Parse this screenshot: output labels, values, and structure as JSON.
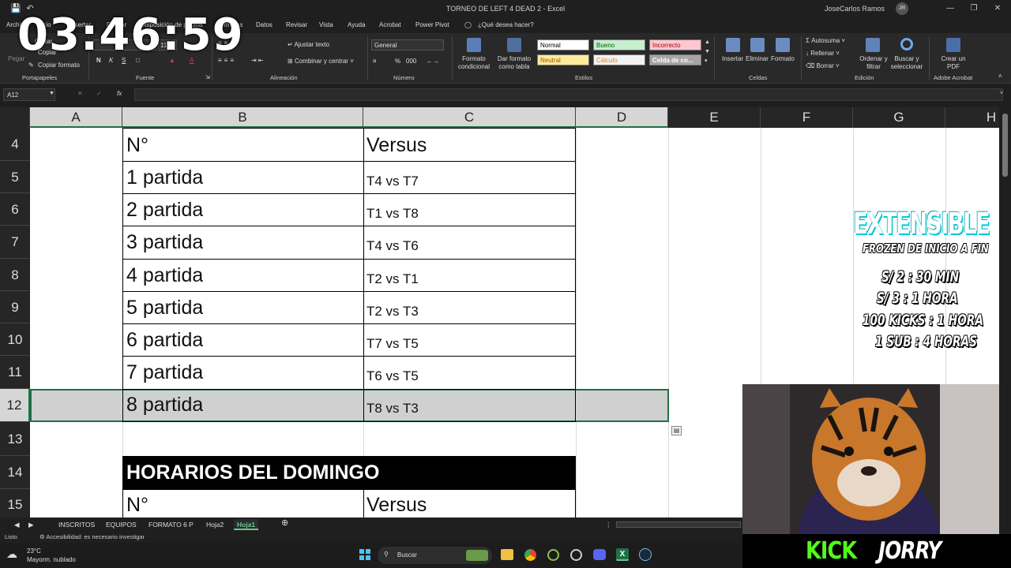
{
  "window": {
    "title": "TORNEO DE LEFT 4 DEAD 2  -  Excel",
    "user": "JoseCarlos Ramos",
    "user_initials": "JR"
  },
  "menu_tabs": [
    "Archivo",
    "Inicio",
    "Insertar",
    "Dibujar",
    "Disposición de página",
    "Fórmulas",
    "Datos",
    "Revisar",
    "Vista",
    "Ayuda",
    "Acrobat",
    "Power Pivot",
    "¿Qué desea hacer?"
  ],
  "ribbon": {
    "clipboard": {
      "cut": "Cortar",
      "copy": "Copiar",
      "paste": "Pegar",
      "format_painter": "Copiar formato",
      "label": "Portapapeles"
    },
    "font": {
      "bold": "N",
      "italic": "K",
      "underline": "S",
      "label": "Fuente",
      "size": "11"
    },
    "alignment": {
      "wrap": "Ajustar texto",
      "merge": "Combinar y centrar",
      "label": "Alineación"
    },
    "number": {
      "format": "General",
      "label": "Número",
      "percent": "%",
      "thousands": "000"
    },
    "styles": {
      "conditional": "Formato condicional",
      "as_table": "Dar formato como tabla",
      "normal": "Normal",
      "bueno": "Bueno",
      "incorrecto": "Incorrecto",
      "neutral": "Neutral",
      "calculo": "Cálculo",
      "celda": "Celda de co...",
      "label": "Estilos",
      "colors": {
        "normal": "#ffffff",
        "bueno": "#c6efce",
        "bueno_text": "#006100",
        "incorrecto": "#ffc7ce",
        "incorrecto_text": "#9c0006",
        "neutral": "#ffeb9c",
        "neutral_text": "#9c5700",
        "calculo": "#f2f2f2",
        "calculo_text": "#fa7d00",
        "celda": "#a5a5a5"
      }
    },
    "cells": {
      "insert": "Insertar",
      "delete": "Eliminar",
      "format": "Formato",
      "label": "Celdas"
    },
    "editing": {
      "autosum": "Autosuma",
      "fill": "Rellenar",
      "clear": "Borrar",
      "sort": "Ordenar y filtrar",
      "find": "Buscar y seleccionar",
      "label": "Edición"
    },
    "acrobat": {
      "create": "Crear un PDF",
      "label": "Adobe Acrobat"
    }
  },
  "formula_bar": {
    "name_box": "A12",
    "fx": "fx",
    "value": ""
  },
  "columns": [
    "A",
    "B",
    "C",
    "D",
    "E",
    "F",
    "G",
    "H"
  ],
  "rows": [
    {
      "num": "4",
      "b": "N°",
      "c": "Versus"
    },
    {
      "num": "5",
      "b": "1 partida",
      "c": "T4 vs T7"
    },
    {
      "num": "6",
      "b": "2 partida",
      "c": "T1 vs T8"
    },
    {
      "num": "7",
      "b": "3 partida",
      "c": "T4 vs T6"
    },
    {
      "num": "8",
      "b": "4 partida",
      "c": "T2 vs T1"
    },
    {
      "num": "9",
      "b": "5 partida",
      "c": "T2 vs T3"
    },
    {
      "num": "10",
      "b": "6 partida",
      "c": "T7 vs T5"
    },
    {
      "num": "11",
      "b": "7 partida",
      "c": "T6 vs T5"
    },
    {
      "num": "12",
      "b": "8 partida",
      "c": "T8 vs T3"
    },
    {
      "num": "13",
      "b": "",
      "c": ""
    },
    {
      "num": "14",
      "b": "HORARIOS DEL DOMINGO",
      "c": ""
    },
    {
      "num": "15",
      "b": "N°",
      "c": "Versus"
    }
  ],
  "sheet_tabs": [
    "INSCRITOS",
    "EQUIPOS",
    "FORMATO 6 P",
    "Hoja2",
    "Hoja1"
  ],
  "active_sheet": "Hoja1",
  "status": {
    "ready": "Listo",
    "accessibility": "Accesibilidad: es necesario investigar"
  },
  "taskbar": {
    "temp": "23°C",
    "weather": "Mayorm. nublado",
    "search": "Buscar"
  },
  "overlay": {
    "timer": "03:46:59",
    "promo_title": "EXTENSIBLE",
    "promo_sub": "FROZEN DE INICIO A FIN",
    "promo_lines": [
      "S/ 2 : 30 MIN",
      "S/ 3  : 1 HORA",
      "100 KICKS : 1 HORA",
      "1 SUB : 4 HORAS"
    ],
    "kick": "KICK",
    "channel": "JORRY"
  }
}
